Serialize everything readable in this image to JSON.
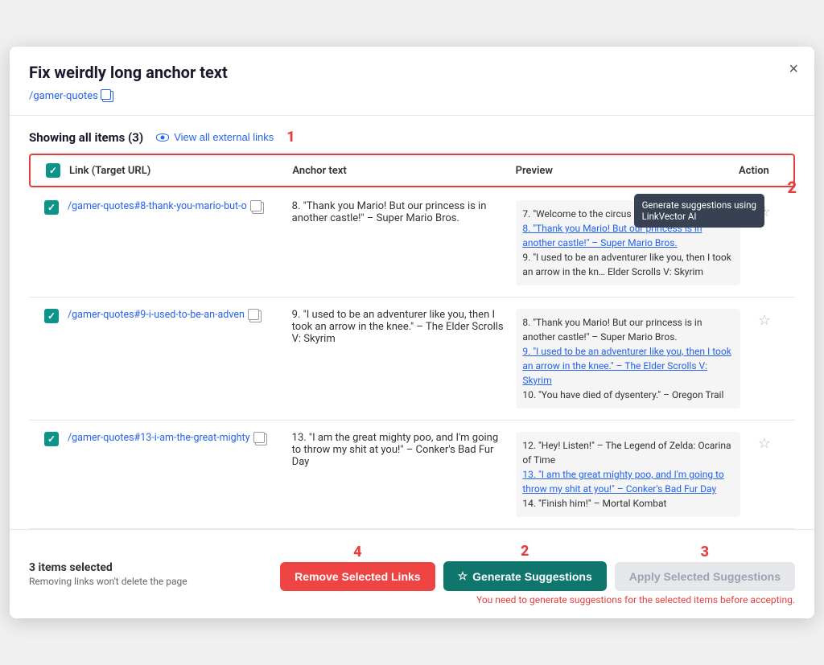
{
  "modal": {
    "title": "Fix weirdly long anchor text",
    "link_text": "/gamer-quotes",
    "close_label": "×"
  },
  "toolbar": {
    "showing_text": "Showing all items (3)",
    "view_external_label": "View all external links"
  },
  "table": {
    "headers": {
      "link": "Link (Target URL)",
      "anchor": "Anchor text",
      "preview": "Preview",
      "action": "Action"
    },
    "rows": [
      {
        "link": "/gamer-quotes#8-thank-you-mario-but-o",
        "anchor": "8. \"Thank you Mario! But our princess is in another castle!\" – Super Mario Bros.",
        "preview_before": "7. \"Welcome to the circus of values!\" – BioShock",
        "preview_linked": "8. \"Thank you Mario! But our princess is in another castle!\" – Super Mario Bros.",
        "preview_after": "9. \"I used to be an adventurer like you, then I took an arrow in the kn… Elder Scrolls V: Skyrim",
        "has_tooltip": true
      },
      {
        "link": "/gamer-quotes#9-i-used-to-be-an-adven",
        "anchor": "9. \"I used to be an adventurer like you, then I took an arrow in the knee.\" – The Elder Scrolls V: Skyrim",
        "preview_before": "8. \"Thank you Mario! But our princess is in another castle!\" – Super Mario Bros.",
        "preview_linked": "9. \"I used to be an adventurer like you, then I took an arrow in the knee.\" – The Elder Scrolls V: Skyrim",
        "preview_after": "10. \"You have died of dysentery.\" – Oregon Trail",
        "has_tooltip": false
      },
      {
        "link": "/gamer-quotes#13-i-am-the-great-mighty",
        "anchor": "13. \"I am the great mighty poo, and I'm going to throw my shit at you!\" – Conker's Bad Fur Day",
        "preview_before": "12. \"Hey! Listen!\" – The Legend of Zelda: Ocarina of Time",
        "preview_linked": "13. \"I am the great mighty poo, and I'm going to throw my shit at you!\" – Conker's Bad Fur Day",
        "preview_after": "14. \"Finish him!\" – Mortal Kombat",
        "has_tooltip": false
      }
    ]
  },
  "footer": {
    "items_selected": "3 items selected",
    "remove_warning": "Removing links won't delete the page",
    "btn_remove": "Remove Selected Links",
    "btn_generate": "Generate Suggestions",
    "btn_apply": "Apply Selected Suggestions",
    "error_text": "You need to generate suggestions for the selected items before accepting.",
    "step_numbers": {
      "remove": "4",
      "generate": "2",
      "apply": "3"
    }
  },
  "tooltip": {
    "text": "Generate suggestions using\nLinkVector AI"
  },
  "step_badge_header": "1"
}
